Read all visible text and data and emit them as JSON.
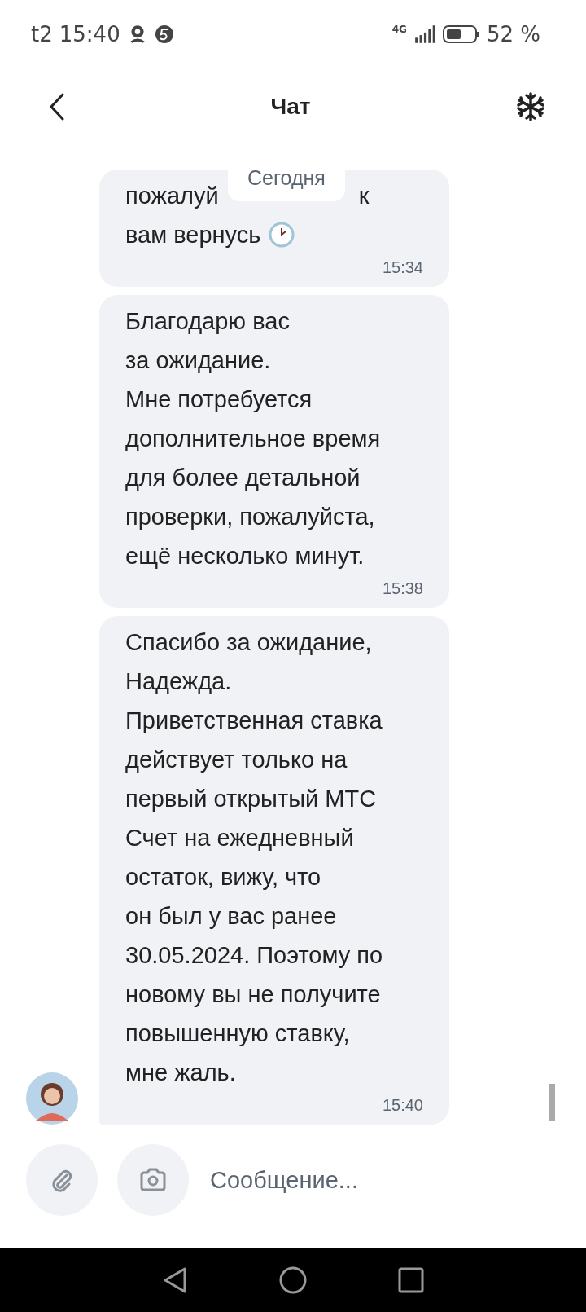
{
  "status_bar": {
    "carrier": "t2",
    "time": "15:40",
    "network": "4G",
    "battery": "52 %"
  },
  "header": {
    "title": "Чат"
  },
  "date_chip": "Сегодня",
  "messages": [
    {
      "lines": [
        [
          "пожалуй",
          "к"
        ],
        [
          "вам вернусь"
        ]
      ],
      "clock_emoji": true,
      "time": "15:34",
      "avatar": false
    },
    {
      "lines": [
        [
          "Благодарю вас"
        ],
        [
          "за ожидание."
        ],
        [
          "Мне потребуется"
        ],
        [
          "дополнительное время"
        ],
        [
          "для более детальной"
        ],
        [
          "проверки, пожалуйста,"
        ],
        [
          "ещё несколько минут."
        ]
      ],
      "clock_emoji": false,
      "time": "15:38",
      "avatar": false
    },
    {
      "lines": [
        [
          "Спасибо за ожидание,"
        ],
        [
          "Надежда."
        ],
        [
          "Приветственная ставка"
        ],
        [
          "действует только на"
        ],
        [
          "первый открытый МТС"
        ],
        [
          "Счет на ежедневный"
        ],
        [
          "остаток, вижу, что"
        ],
        [
          "он был у вас ранее"
        ],
        [
          "30.05.2024. Поэтому по"
        ],
        [
          "новому вы не получите"
        ],
        [
          "повышенную ставку,"
        ],
        [
          "мне жаль."
        ]
      ],
      "clock_emoji": false,
      "time": "15:40",
      "avatar": true
    }
  ],
  "composer": {
    "placeholder": "Сообщение..."
  }
}
